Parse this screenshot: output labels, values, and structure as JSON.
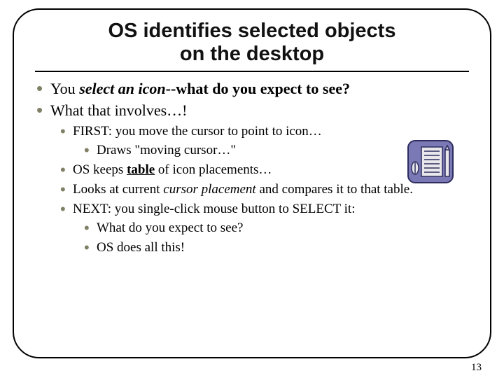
{
  "title_line1": "OS identifies selected objects",
  "title_line2": "on the desktop",
  "bullets": {
    "b1_pre": "You ",
    "b1_em": "select an icon",
    "b1_post": "--what do you expect to see?",
    "b2": "What that involves…!",
    "b2_1": "FIRST:  you move the cursor to point to icon…",
    "b2_1_1": "Draws \"moving cursor…\"",
    "b2_2_pre": "OS keeps ",
    "b2_2_link": "table",
    "b2_2_post": " of icon placements…",
    "b2_3_pre": "Looks at current ",
    "b2_3_em": "cursor placement",
    "b2_3_post": " and compares it to that table.",
    "b2_4": "NEXT:  you single-click mouse button to SELECT it:",
    "b2_4_1": "What do you expect to see?",
    "b2_4_2": "OS does all this!"
  },
  "page_number": "13"
}
